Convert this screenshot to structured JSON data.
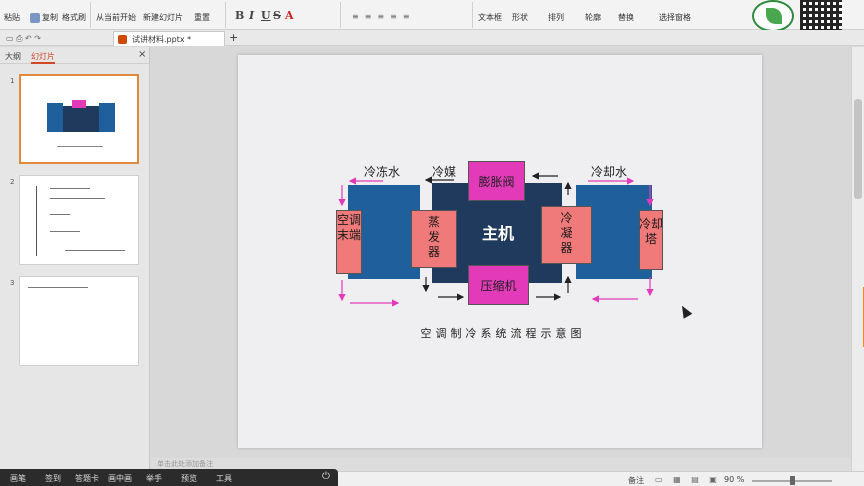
{
  "ribbon": {
    "paste": "粘贴",
    "copy": "复制",
    "format_painter": "格式刷",
    "from_current": "从当前开始",
    "new_slide": "新建幻灯片",
    "reset": "重置",
    "bold": "B",
    "italic": "I",
    "underline": "U",
    "strike": "S",
    "font_color": "A",
    "textbox": "文本框",
    "shape": "形状",
    "arrange": "排列",
    "outline": "轮廓",
    "replace": "替换",
    "select_pane": "选择窗格"
  },
  "tabbar": {
    "doc_title": "试讲材料.pptx *",
    "add_tab": "+"
  },
  "pane": {
    "tab_outline": "大纲",
    "tab_slides": "幻灯片",
    "close": "×",
    "slides": [
      {
        "num": "1"
      },
      {
        "num": "2"
      },
      {
        "num": "3"
      }
    ]
  },
  "diagram": {
    "chilled_water": "冷冻水",
    "refrigerant": "冷媒",
    "cooling_water": "冷却水",
    "expansion_valve": "膨胀阀",
    "main_unit": "主机",
    "compressor": "压缩机",
    "ac_terminal": "空调末端",
    "evaporator": "蒸发器",
    "condenser": "冷凝器",
    "cooling_tower": "冷却塔",
    "caption": "空调制冷系统流程示意图",
    "colors": {
      "navy": "#1f3a5c",
      "blue": "#1f5f9c",
      "pink": "#f07a7a",
      "magenta": "#e23ab8"
    }
  },
  "notes_placeholder": "单击此处添加备注",
  "taskbar": [
    "画笔",
    "签到",
    "答题卡",
    "画中画",
    "举手",
    "预览",
    "工具"
  ],
  "status": {
    "notes": "备注",
    "zoom": "90 %"
  }
}
